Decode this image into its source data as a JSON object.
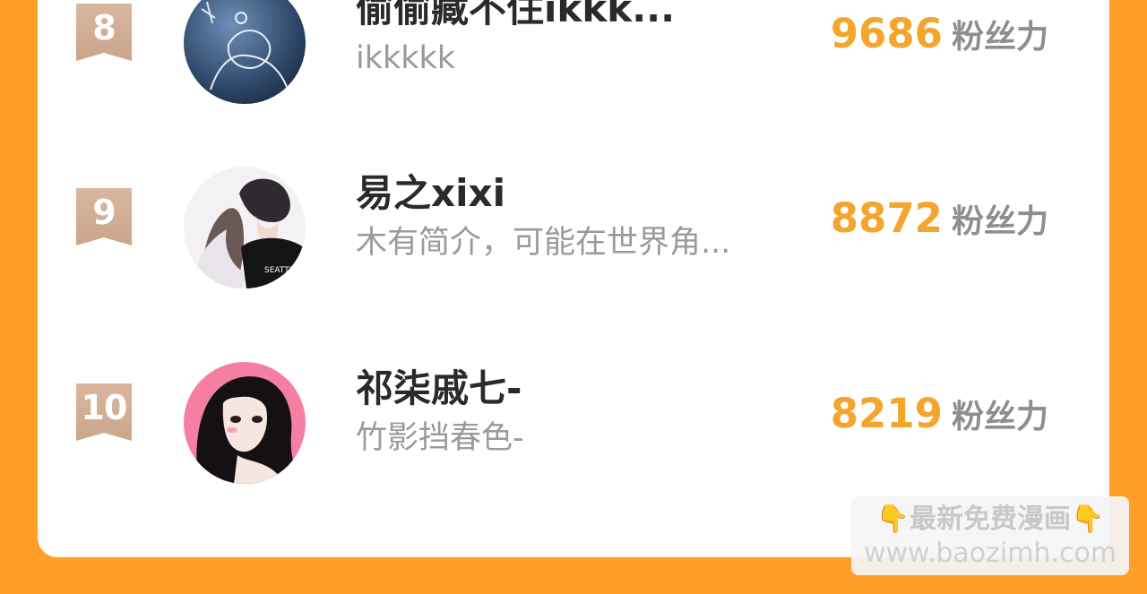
{
  "ranking": {
    "fans_label": "粉丝力",
    "items": [
      {
        "rank": "8",
        "name": "偷偷藏不住ikkk...",
        "bio": "ikkkkk",
        "fans": "9686",
        "avatar": "avatar-dark-sketch"
      },
      {
        "rank": "9",
        "name": "易之xixi",
        "bio": "木有简介，可能在世界角...",
        "fans": "8872",
        "avatar": "avatar-couple-illustration"
      },
      {
        "rank": "10",
        "name": "祁柒戚七-",
        "bio": "竹影挡春色-",
        "fans": "8219",
        "avatar": "avatar-anime-girl"
      }
    ]
  },
  "watermark": {
    "emoji_left": "👇",
    "title": "最新免费漫画",
    "emoji_right": "👇",
    "url": "www.baozimh.com"
  },
  "colors": {
    "background": "#FF9F2A",
    "card": "#FFFFFF",
    "rank_badge": "#D2AE94",
    "fans_number": "#F3A52C"
  }
}
